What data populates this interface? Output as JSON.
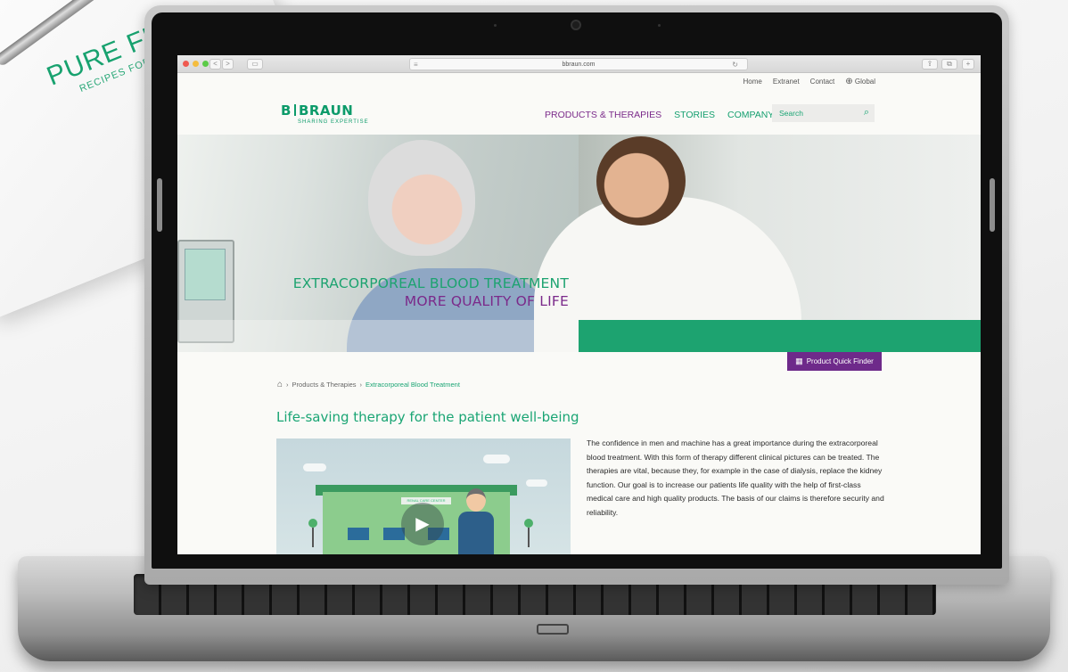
{
  "backdrop": {
    "paper_title": "PURE FL",
    "paper_subtitle": "RECIPES FOR"
  },
  "browser": {
    "url": "bbraun.com",
    "back_label": "<",
    "forward_label": ">",
    "sidebar_icon": "sidebar-icon",
    "share_icon": "share-icon",
    "tabs_icon": "tabs-icon",
    "add_tab_label": "+"
  },
  "utility_nav": {
    "items": [
      "Home",
      "Extranet",
      "Contact",
      "Global"
    ],
    "globe_icon": "globe-icon"
  },
  "logo": {
    "left": "B",
    "right": "BRAUN",
    "tagline": "SHARING EXPERTISE"
  },
  "main_nav": {
    "items": [
      {
        "label": "PRODUCTS & THERAPIES",
        "color": "#7b2a8a"
      },
      {
        "label": "STORIES",
        "color": "#15a070"
      },
      {
        "label": "COMPANY",
        "color": "#15a070"
      }
    ]
  },
  "search": {
    "placeholder": "Search",
    "icon": "search-icon"
  },
  "hero": {
    "line1": "EXTRACORPOREAL BLOOD TREATMENT",
    "line2": "MORE QUALITY OF LIFE",
    "line1_color": "#1da370",
    "line2_color": "#7b2a8a"
  },
  "product_quick_finder": {
    "label": "Product Quick Finder",
    "icon": "grid-icon",
    "color": "#6e2a8a"
  },
  "breadcrumb": {
    "home_icon": "home-icon",
    "items": [
      "Products & Therapies",
      "Extracorporeal Blood Treatment"
    ],
    "separator": "›"
  },
  "section": {
    "title": "Life-saving therapy for the patient well-being",
    "video_sign": "RENAL CARE CENTER",
    "play_icon": "play-icon",
    "body": "The confidence in men and machine has a great importance during the extracorporeal blood treatment. With this form of therapy different clinical pictures can be treated. The therapies are vital, because they, for example in the case of dialysis, replace the kidney function. Our goal is to increase our patients life quality with the help of first-class medical care and high quality products. The basis of our claims is therefore security and reliability."
  },
  "colors": {
    "brand_green": "#1aa574",
    "brand_purple": "#7b2a8a"
  }
}
